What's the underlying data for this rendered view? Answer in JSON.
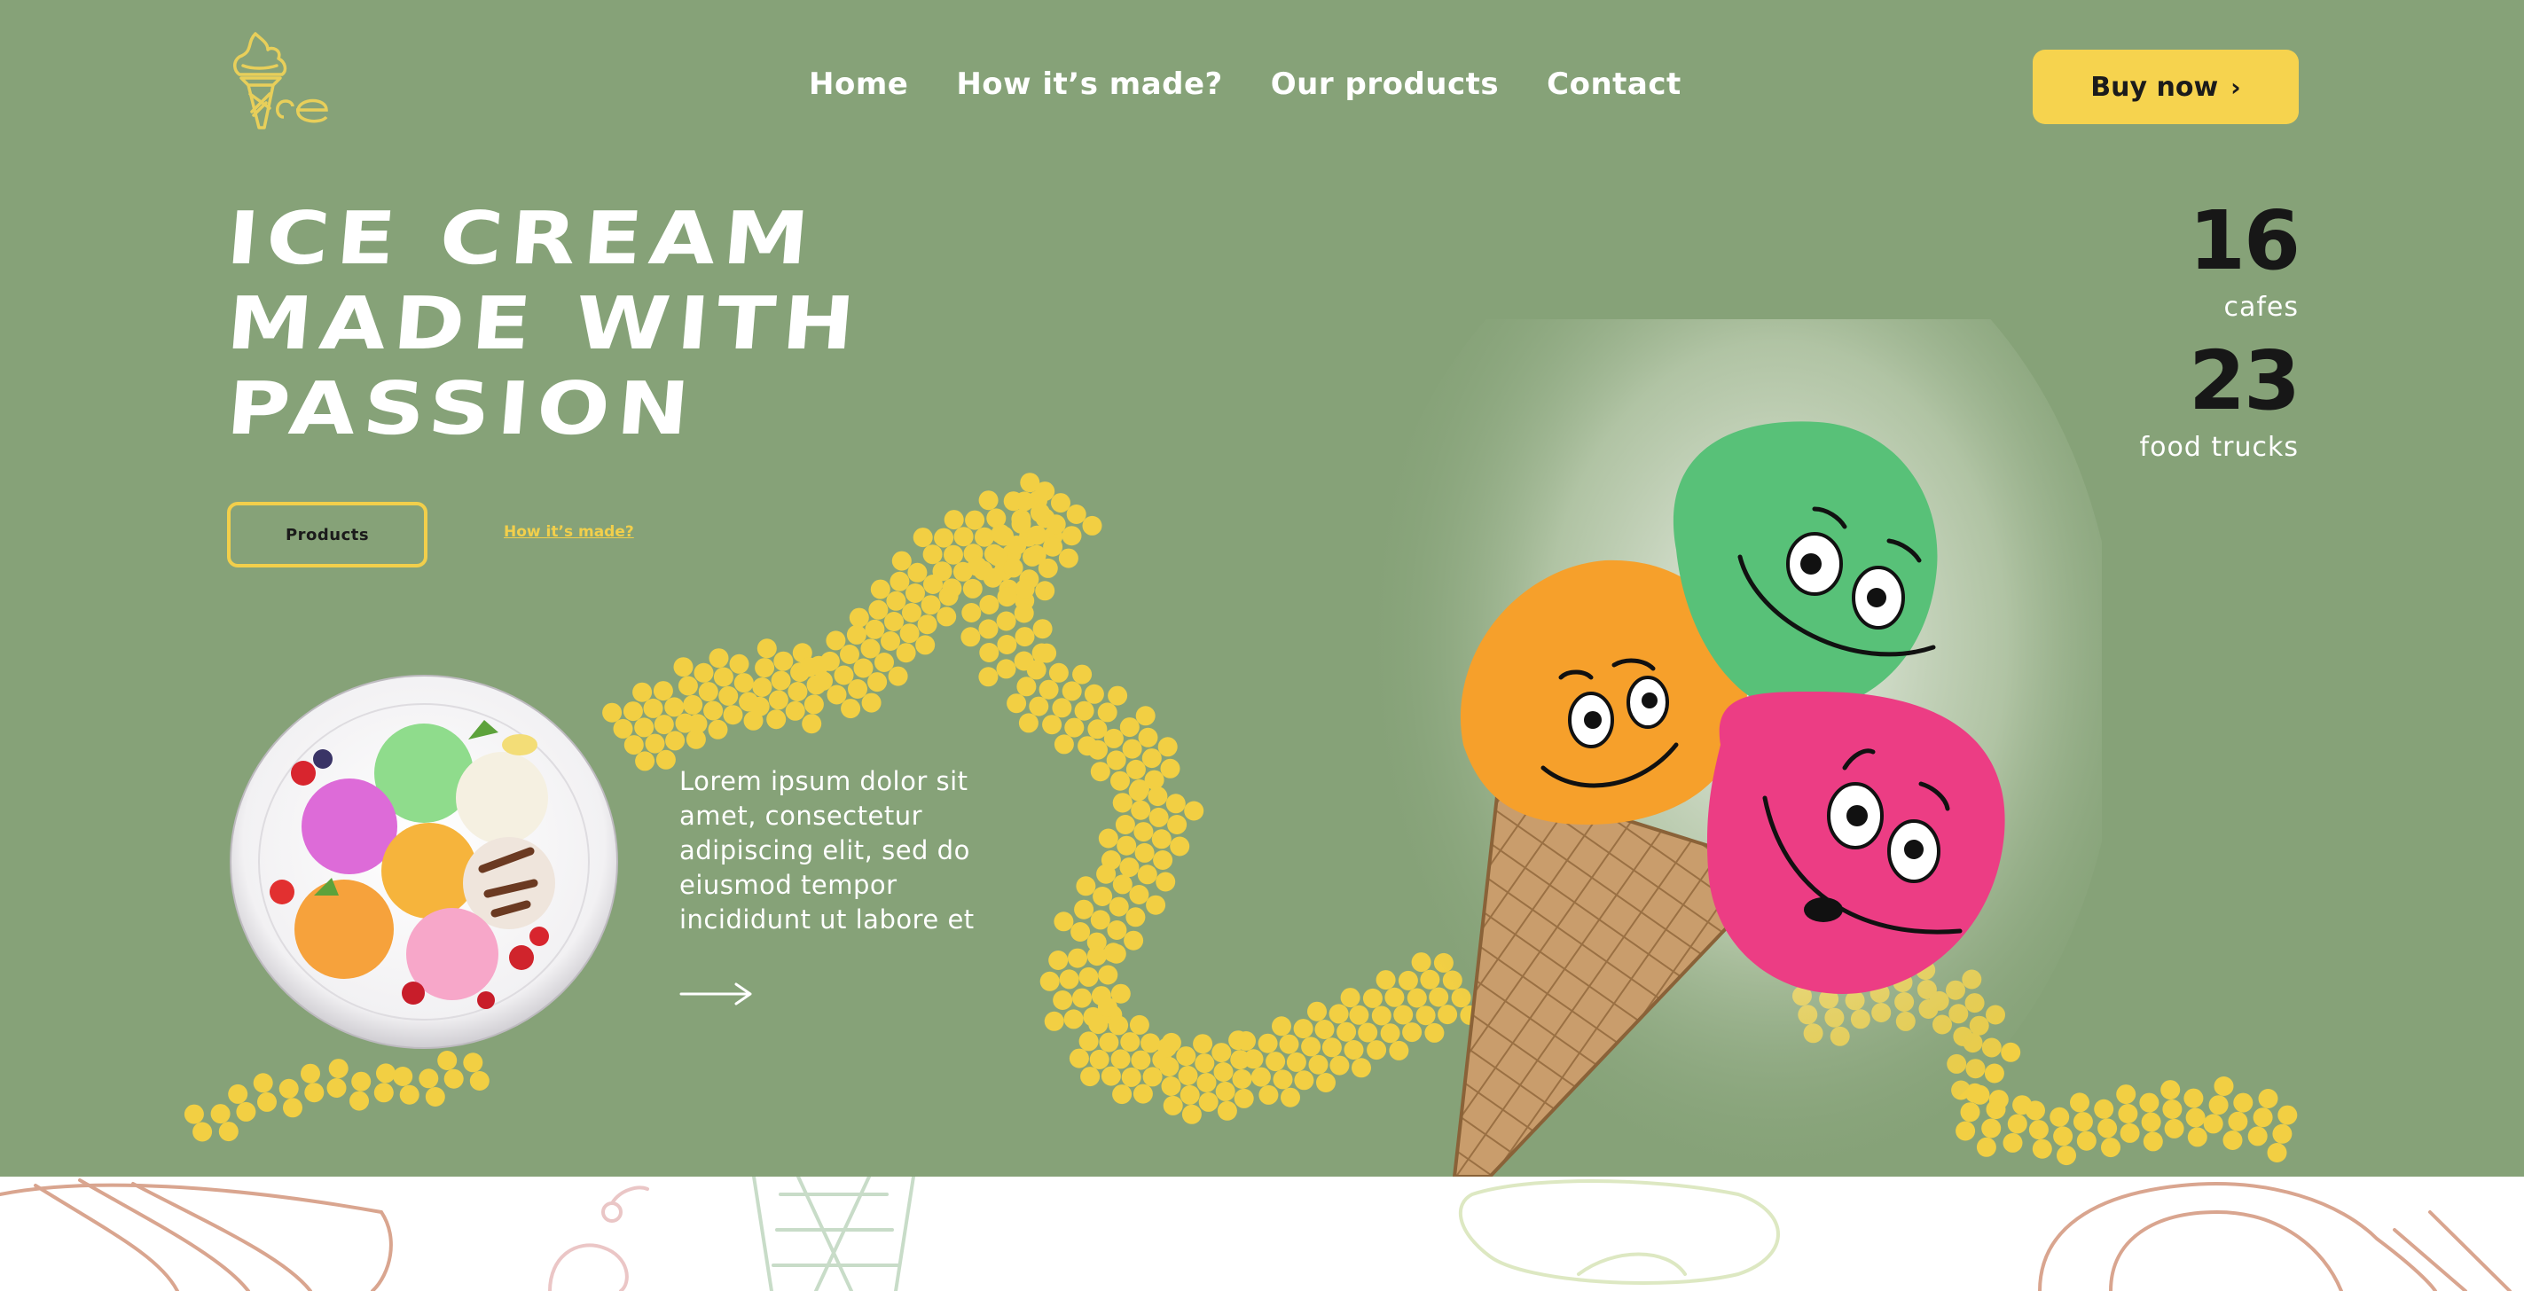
{
  "brand": {
    "logo_text": "ice",
    "logo_color": "#e8cf5a"
  },
  "nav": {
    "items": [
      {
        "label": "Home"
      },
      {
        "label": "How it’s made?"
      },
      {
        "label": "Our products"
      },
      {
        "label": "Contact"
      }
    ]
  },
  "cta": {
    "buy_label": "Buy now",
    "buy_icon": "chevron-right-icon"
  },
  "hero": {
    "headline_lines": [
      "ICE CREAM",
      "MADE WITH",
      "PASSION"
    ],
    "products_button": "Products",
    "how_link": "How it’s made?",
    "body_lines": [
      "Lorem ipsum dolor sit",
      "amet, consectetur",
      "adipiscing elit, sed do",
      "eiusmod tempor",
      "incididunt ut labore et"
    ],
    "arrow_icon": "arrow-right-icon"
  },
  "stats": [
    {
      "value": "16",
      "label": "cafes"
    },
    {
      "value": "23",
      "label": "food trucks"
    }
  ],
  "colors": {
    "background": "#86a278",
    "accent": "#f6d34e",
    "dots": "#f2cf43",
    "text_light": "#ffffff",
    "text_dark": "#171717",
    "strip_sketch": "#d9a58f"
  }
}
